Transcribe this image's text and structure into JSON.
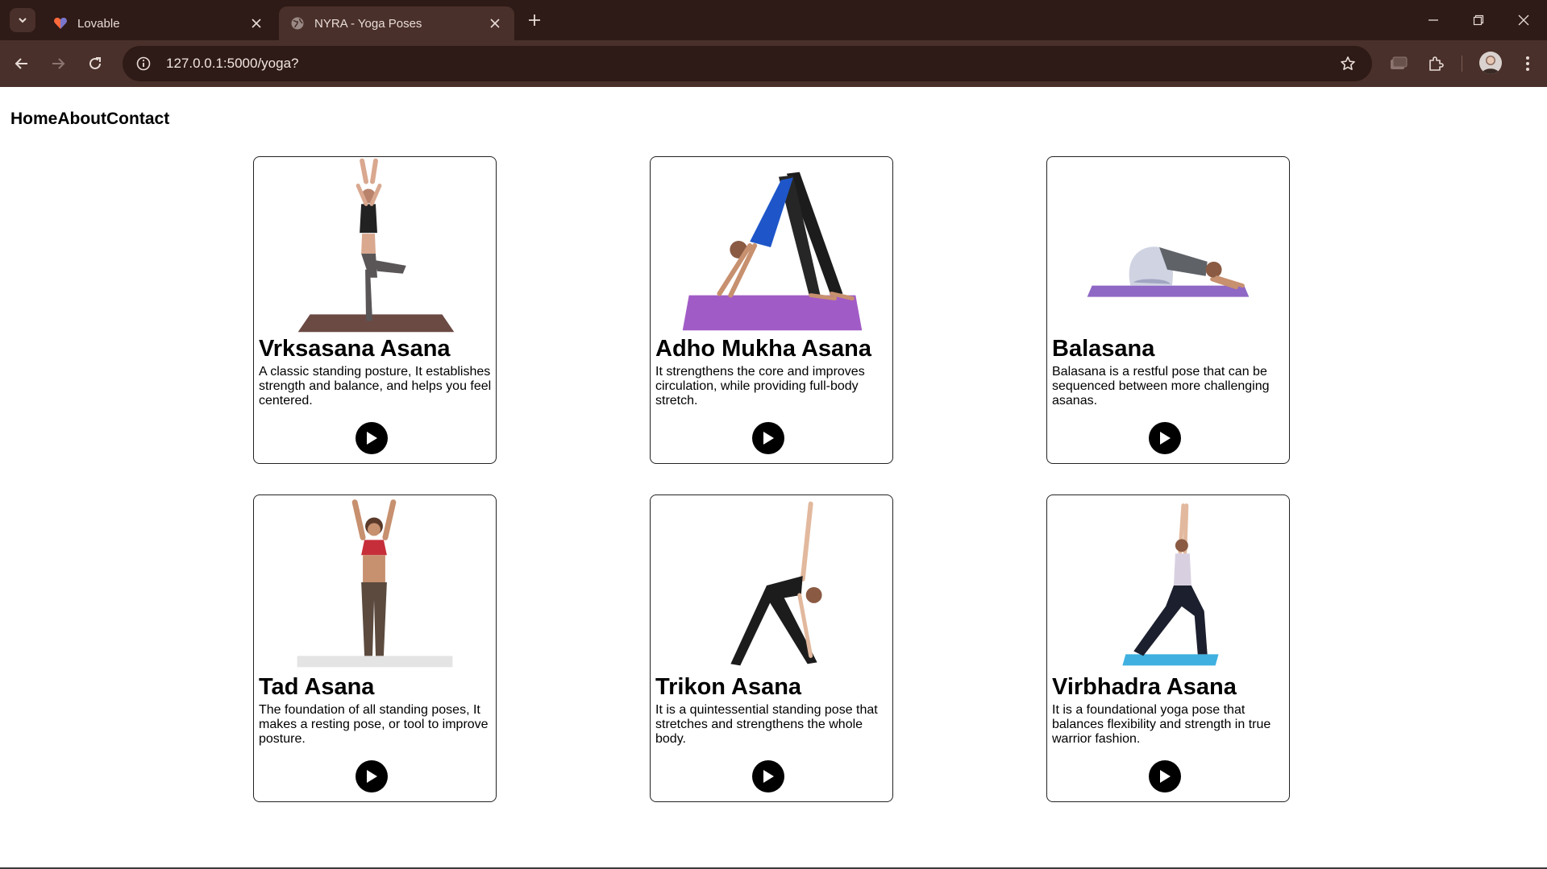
{
  "browser": {
    "tabs": [
      {
        "title": "Lovable",
        "active": false,
        "favicon": "heart-icon"
      },
      {
        "title": "NYRA - Yoga Poses",
        "active": true,
        "favicon": "globe-icon"
      }
    ],
    "url": "127.0.0.1:5000/yoga?",
    "colors": {
      "tabstrip": "#2e1a16",
      "toolbar": "#4a302a"
    }
  },
  "nav": {
    "home": "Home",
    "about": "About",
    "contact": "Contact"
  },
  "poses": [
    {
      "name": "Vrksasana Asana",
      "description": "A classic standing posture, It establishes strength and balance, and helps you feel centered.",
      "image": "tree-pose-photo"
    },
    {
      "name": "Adho Mukha Asana",
      "description": "It strengthens the core and improves circulation, while providing full-body stretch.",
      "image": "downward-dog-photo"
    },
    {
      "name": "Balasana",
      "description": "Balasana is a restful pose that can be sequenced between more challenging asanas.",
      "image": "child-pose-photo"
    },
    {
      "name": "Tad Asana",
      "description": "The foundation of all standing poses, It makes a resting pose, or tool to improve posture.",
      "image": "mountain-pose-photo"
    },
    {
      "name": "Trikon Asana",
      "description": "It is a quintessential standing pose that stretches and strengthens the whole body.",
      "image": "triangle-pose-photo"
    },
    {
      "name": "Virbhadra Asana",
      "description": "It is a foundational yoga pose that balances flexibility and strength in true warrior fashion.",
      "image": "warrior-pose-photo"
    }
  ]
}
